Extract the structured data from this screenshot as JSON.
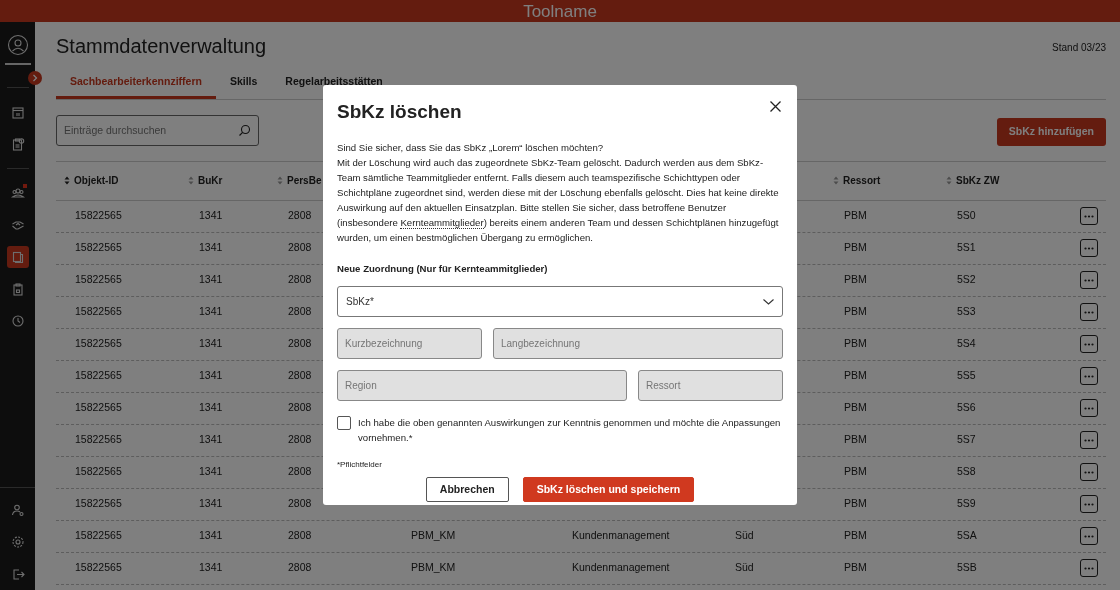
{
  "app_bar": {
    "title": "Toolname"
  },
  "sidebar": {
    "sections": [
      {
        "items": [
          {
            "selected": false
          },
          {
            "selected": false
          }
        ]
      },
      {
        "items": [
          {
            "selected": false,
            "notification": true
          },
          {
            "selected": false,
            "notification": false
          },
          {
            "selected": true,
            "notification": false
          },
          {
            "selected": false,
            "notification": false
          },
          {
            "selected": false,
            "notification": false
          }
        ]
      }
    ],
    "bottom_items": [
      {
        "selected": false
      },
      {
        "selected": false
      },
      {
        "selected": false
      }
    ]
  },
  "page": {
    "title": "Stammdatenverwaltung",
    "version": "Stand 03/23"
  },
  "tabs": [
    {
      "label": "Sachbearbeiterkennziffern",
      "selected": true
    },
    {
      "label": "Skills",
      "selected": false
    },
    {
      "label": "Regelarbeitsstätten",
      "selected": false
    }
  ],
  "search": {
    "placeholder": "Einträge durchsuchen"
  },
  "add_button": "SbKz hinzufügen",
  "table": {
    "headers": {
      "objekt_id": {
        "label": "Objekt-ID",
        "sorted": true
      },
      "bukr": {
        "label": "BuKr",
        "sorted": false
      },
      "persbe": {
        "label": "PersBe",
        "sorted": false
      },
      "ressort": {
        "label": "Ressort",
        "sorted": false
      },
      "sbkz_zw": {
        "label": "SbKz ZW",
        "sorted": false
      }
    },
    "rows": [
      {
        "objekt_id": "15822565",
        "bukr": "1341",
        "persbe": "2808",
        "ressort": "PBM",
        "sbkz_zw": "5S0"
      },
      {
        "objekt_id": "15822565",
        "bukr": "1341",
        "persbe": "2808",
        "ressort": "PBM",
        "sbkz_zw": "5S1"
      },
      {
        "objekt_id": "15822565",
        "bukr": "1341",
        "persbe": "2808",
        "ressort": "PBM",
        "sbkz_zw": "5S2"
      },
      {
        "objekt_id": "15822565",
        "bukr": "1341",
        "persbe": "2808",
        "ressort": "PBM",
        "sbkz_zw": "5S3"
      },
      {
        "objekt_id": "15822565",
        "bukr": "1341",
        "persbe": "2808",
        "ressort": "PBM",
        "sbkz_zw": "5S4"
      },
      {
        "objekt_id": "15822565",
        "bukr": "1341",
        "persbe": "2808",
        "ressort": "PBM",
        "sbkz_zw": "5S5"
      },
      {
        "objekt_id": "15822565",
        "bukr": "1341",
        "persbe": "2808",
        "ressort": "PBM",
        "sbkz_zw": "5S6"
      },
      {
        "objekt_id": "15822565",
        "bukr": "1341",
        "persbe": "2808",
        "ressort": "PBM",
        "sbkz_zw": "5S7"
      },
      {
        "objekt_id": "15822565",
        "bukr": "1341",
        "persbe": "2808",
        "ressort": "PBM",
        "sbkz_zw": "5S8"
      },
      {
        "objekt_id": "15822565",
        "bukr": "1341",
        "persbe": "2808",
        "ressort": "PBM",
        "sbkz_zw": "5S9"
      },
      {
        "objekt_id": "15822565",
        "bukr": "1341",
        "persbe": "2808",
        "column_4": "PBM_KM",
        "column_5": "Kundenmanagement",
        "column_6": "Süd",
        "ressort": "PBM",
        "sbkz_zw": "5SA"
      },
      {
        "objekt_id": "15822565",
        "bukr": "1341",
        "persbe": "2808",
        "column_4": "PBM_KM",
        "column_5": "Kundenmanagement",
        "column_6": "Süd",
        "ressort": "PBM",
        "sbkz_zw": "5SB"
      }
    ]
  },
  "dialog": {
    "title": "SbKz löschen",
    "question": "Sind Sie sicher, dass Sie das SbKz „Lorem“ löschen möchten?",
    "body_before": "Mit der Löschung wird auch das zugeordnete SbKz-Team gelöscht. Dadurch werden aus dem SbKz-Team sämtliche Teammitglieder entfernt. Falls diesem auch teamspezifische Schichttypen oder Schichtpläne zugeordnet sind, werden diese mit der Löschung ebenfalls gelöscht. Dies hat keine direkte Auswirkung auf den aktuellen Einsatzplan. Bitte stellen Sie sicher, dass betroffene Benutzer (insbesondere",
    "body_link": "Kernteammitglieder",
    "body_after": ") bereits einem anderen Team und dessen Schichtplänen hinzugefügt wurden, um einen bestmöglichen Übergang zu ermöglichen.",
    "section_label": "Neue Zuordnung (Nur für Kernteammitglieder)",
    "select": {
      "placeholder": "SbKz*"
    },
    "fields": [
      {
        "placeholder": "Kurzbezeichnung",
        "disabled": true
      },
      {
        "placeholder": "Langbezeichnung",
        "disabled": true
      },
      {
        "placeholder": "Region",
        "disabled": true
      },
      {
        "placeholder": "Ressort",
        "disabled": true
      }
    ],
    "confirm": {
      "label": "Ich habe die oben genannten Auswirkungen zur Kenntnis genommen und möchte die Anpassungen vornehmen.*",
      "checked": false
    },
    "required_note": "*Pflichtfelder",
    "buttons": [
      {
        "label": "Abbrechen",
        "kind": "secondary"
      },
      {
        "label": "SbKz löschen und speichern",
        "kind": "primary"
      }
    ]
  }
}
